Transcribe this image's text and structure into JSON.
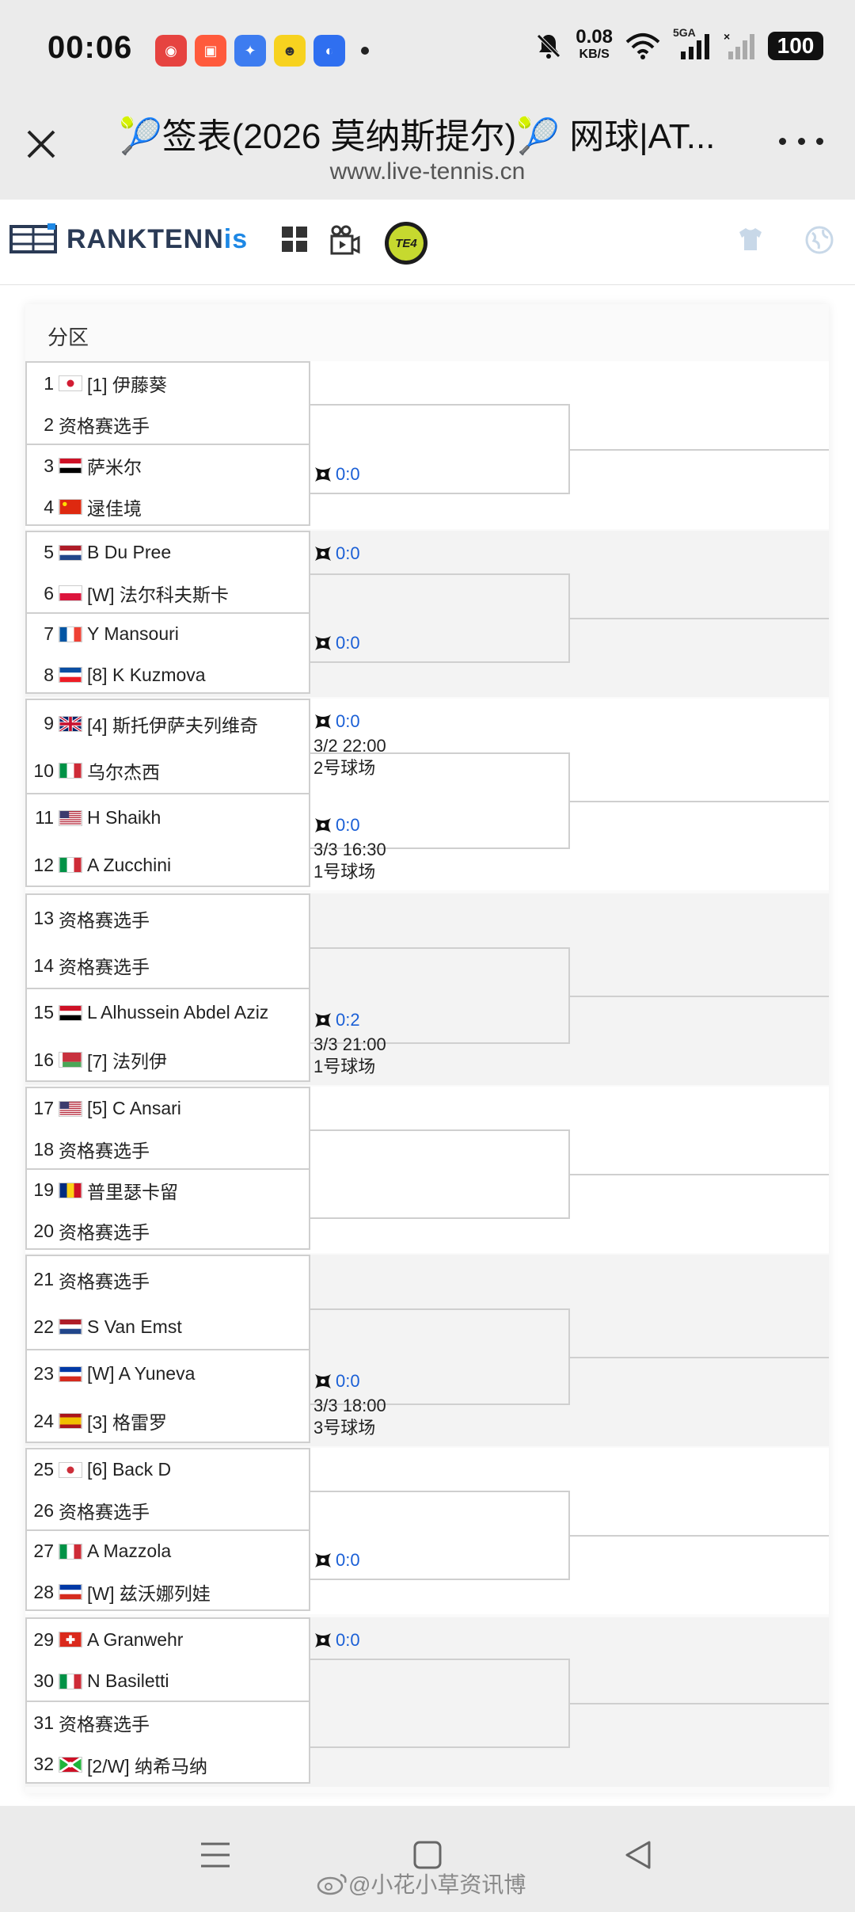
{
  "status": {
    "time": "00:06",
    "net_speed": "0.08",
    "net_unit": "KB/S",
    "signal_label": "5GA",
    "battery": "100"
  },
  "browser": {
    "title": "🎾签表(2026 莫纳斯提尔)🎾 网球|AT...",
    "url": "www.live-tennis.cn"
  },
  "site": {
    "logo_main": "RANKTENN",
    "logo_accent": "is",
    "badge": "TE4"
  },
  "section_label": "分区",
  "players": [
    {
      "no": "1",
      "name": "[1] 伊藤葵",
      "flag": "jp"
    },
    {
      "no": "2",
      "name": "资格赛选手",
      "flag": ""
    },
    {
      "no": "3",
      "name": "萨米尔",
      "flag": "eg"
    },
    {
      "no": "4",
      "name": "逯佳境",
      "flag": "cn"
    },
    {
      "no": "5",
      "name": "B Du Pree",
      "flag": "nl"
    },
    {
      "no": "6",
      "name": "[W] 法尔科夫斯卡",
      "flag": "pl"
    },
    {
      "no": "7",
      "name": "Y Mansouri",
      "flag": "fr"
    },
    {
      "no": "8",
      "name": "[8] K Kuzmova",
      "flag": "sk"
    },
    {
      "no": "9",
      "name": "[4] 斯托伊萨夫列维奇",
      "flag": "gb"
    },
    {
      "no": "10",
      "name": "乌尔杰西",
      "flag": "it"
    },
    {
      "no": "11",
      "name": "H Shaikh",
      "flag": "us"
    },
    {
      "no": "12",
      "name": "A Zucchini",
      "flag": "it"
    },
    {
      "no": "13",
      "name": "资格赛选手",
      "flag": ""
    },
    {
      "no": "14",
      "name": "资格赛选手",
      "flag": ""
    },
    {
      "no": "15",
      "name": "L Alhussein Abdel Aziz",
      "flag": "eg"
    },
    {
      "no": "16",
      "name": "[7] 法列伊",
      "flag": "by"
    },
    {
      "no": "17",
      "name": "[5] C Ansari",
      "flag": "us"
    },
    {
      "no": "18",
      "name": "资格赛选手",
      "flag": ""
    },
    {
      "no": "19",
      "name": "普里瑟卡留",
      "flag": "ro"
    },
    {
      "no": "20",
      "name": "资格赛选手",
      "flag": ""
    },
    {
      "no": "21",
      "name": "资格赛选手",
      "flag": ""
    },
    {
      "no": "22",
      "name": "S Van Emst",
      "flag": "nl"
    },
    {
      "no": "23",
      "name": "[W] A Yuneva",
      "flag": "ru"
    },
    {
      "no": "24",
      "name": "[3] 格雷罗",
      "flag": "es"
    },
    {
      "no": "25",
      "name": "[6] Back D",
      "flag": "kr"
    },
    {
      "no": "26",
      "name": "资格赛选手",
      "flag": ""
    },
    {
      "no": "27",
      "name": "A Mazzola",
      "flag": "it"
    },
    {
      "no": "28",
      "name": "[W] 兹沃娜列娃",
      "flag": "ru"
    },
    {
      "no": "29",
      "name": "A Granwehr",
      "flag": "ch"
    },
    {
      "no": "30",
      "name": "N Basiletti",
      "flag": "it"
    },
    {
      "no": "31",
      "name": "资格赛选手",
      "flag": ""
    },
    {
      "no": "32",
      "name": "[2/W] 纳希马纳",
      "flag": "bi"
    }
  ],
  "scores": [
    {
      "text": "0:0"
    },
    {
      "text": "0:0"
    },
    {
      "text": "0:0"
    },
    {
      "text": "0:0"
    },
    {
      "text": "0:0"
    },
    {
      "text": "0:2"
    },
    {
      "text": "0:0"
    },
    {
      "text": "0:0"
    },
    {
      "text": "0:0"
    }
  ],
  "schedules": [
    {
      "time": "3/2 22:00",
      "court": "2号球场"
    },
    {
      "time": "3/3 16:30",
      "court": "1号球场"
    },
    {
      "time": "3/3 21:00",
      "court": "1号球场"
    },
    {
      "time": "3/3 18:00",
      "court": "3号球场"
    }
  ],
  "flag_colors": {
    "jp": [
      "#ffffff",
      "#d21c33"
    ],
    "cn": [
      "#de2910",
      "#ffde00"
    ],
    "eg": [
      "#ce1126",
      "#000000"
    ],
    "nl": [
      "#ae1c28",
      "#21468b"
    ],
    "pl": [
      "#ffffff",
      "#dc143c"
    ],
    "fr": [
      "#0055a4",
      "#ef4135"
    ],
    "sk": [
      "#0b4ea2",
      "#ee1c25"
    ],
    "gb": [
      "#012169",
      "#c8102e"
    ],
    "it": [
      "#009246",
      "#ce2b37"
    ],
    "us": [
      "#b22234",
      "#3c3b6e"
    ],
    "by": [
      "#c8313e",
      "#4aa657"
    ],
    "ro": [
      "#002b7f",
      "#ce1126"
    ],
    "ru": [
      "#0039a6",
      "#d52b1e"
    ],
    "es": [
      "#aa151b",
      "#f1bf00"
    ],
    "kr": [
      "#ffffff",
      "#cd2e3a"
    ],
    "ch": [
      "#da291c",
      "#ffffff"
    ],
    "bi": [
      "#1eb53a",
      "#ce1126"
    ]
  },
  "watermark": "@小花小草资讯博"
}
